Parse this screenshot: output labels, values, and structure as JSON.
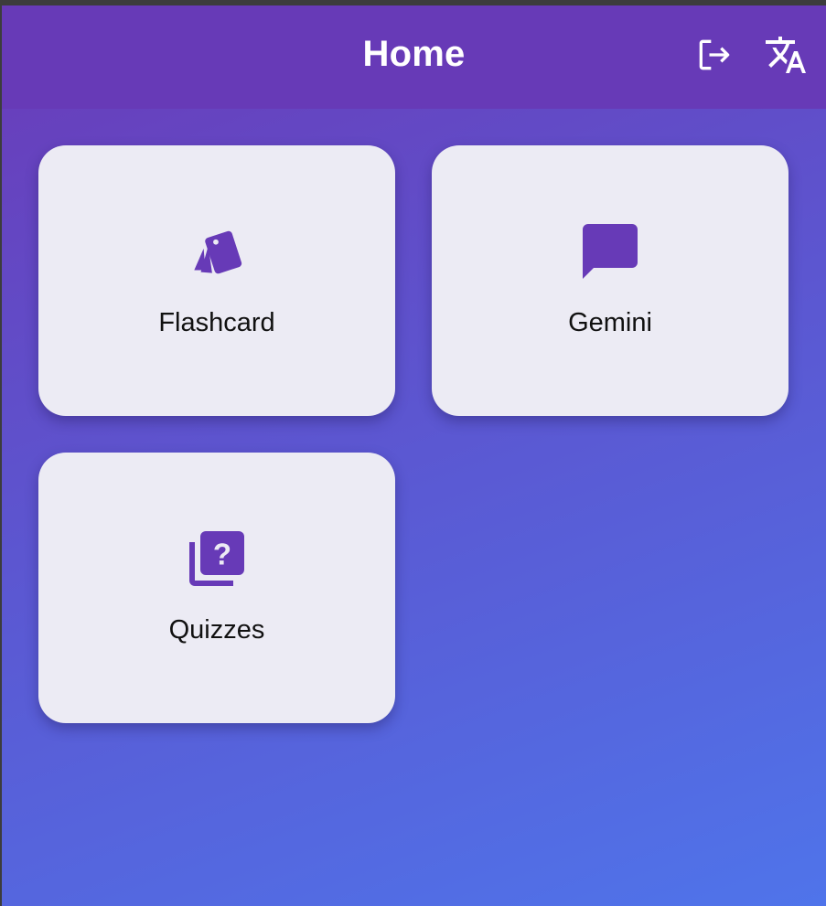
{
  "app_bar": {
    "title": "Home",
    "actions": [
      {
        "icon": "logout-icon"
      },
      {
        "icon": "translate-icon"
      }
    ]
  },
  "menu": {
    "items": [
      {
        "label": "Flashcard",
        "icon": "flashcard-icon"
      },
      {
        "label": "Gemini",
        "icon": "chat-bubble-icon"
      },
      {
        "label": "Quizzes",
        "icon": "quiz-icon"
      }
    ]
  },
  "colors": {
    "primary": "#673ab7",
    "gradient_start": "#6a3bb8",
    "gradient_end": "#4f74ea",
    "card_background": "#ecebf4",
    "icon_color": "#673ab7"
  }
}
